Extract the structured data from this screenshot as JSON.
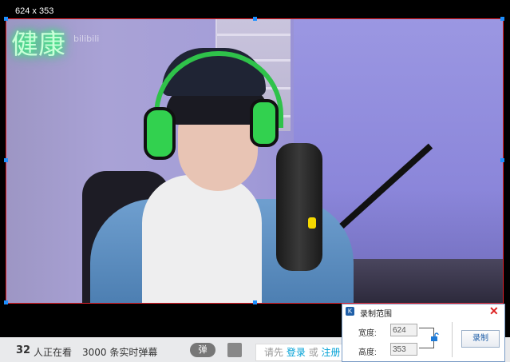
{
  "capture": {
    "size_label": "624 x 353",
    "accent_border": "#e0202a",
    "handle_color": "#1e90ff"
  },
  "video": {
    "neon_sign": "健康",
    "watermark": "bilibili"
  },
  "player_bar": {
    "viewer_count": "32",
    "viewer_suffix": "人正在看",
    "danmaku_info": "3000 条实时弹幕",
    "danmaku_toggle": "弹",
    "login_hint_prefix": "请先",
    "login_link": "登录",
    "login_or": "或",
    "register_link": "注册"
  },
  "dialog": {
    "title": "录制范围",
    "width_label": "宽度:",
    "height_label": "高度:",
    "width_value": "624",
    "height_value": "353",
    "record_button": "录制",
    "close_icon": "close-icon",
    "lock_icon": "unlock-icon"
  }
}
